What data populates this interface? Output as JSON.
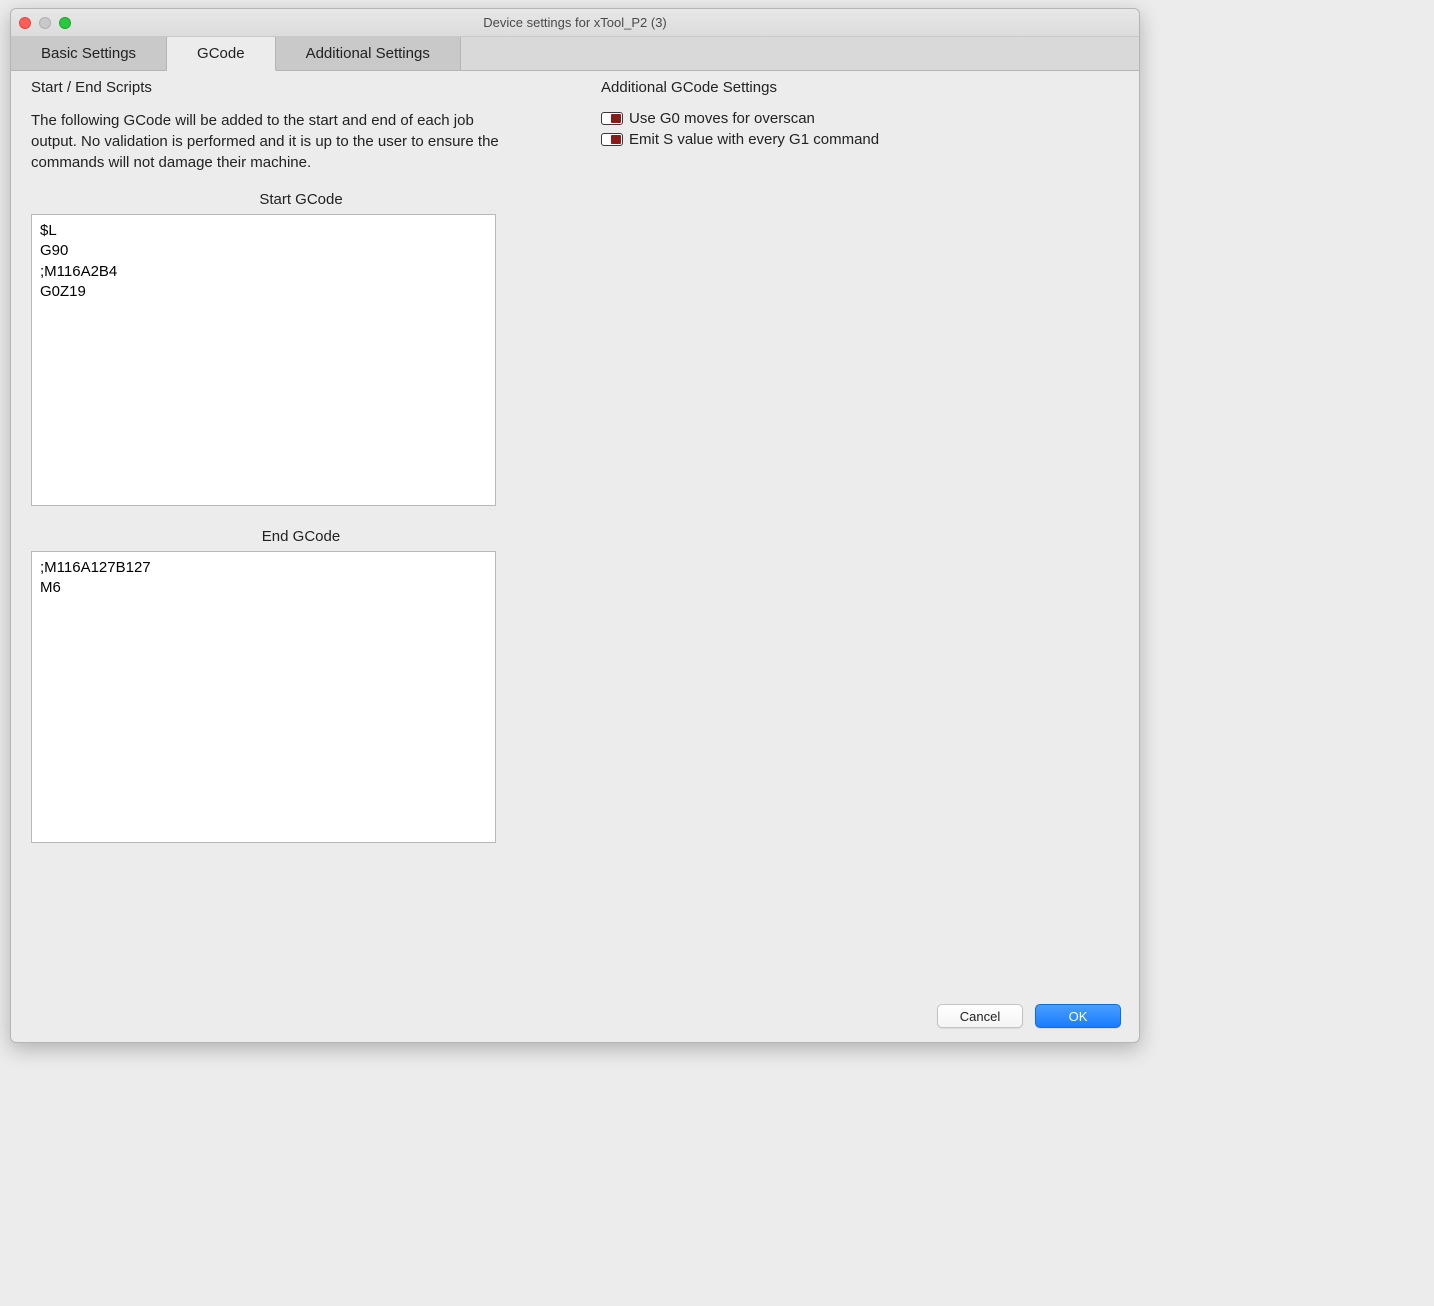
{
  "window": {
    "title": "Device settings for xTool_P2 (3)"
  },
  "tabs": {
    "basic": "Basic Settings",
    "gcode": "GCode",
    "additional": "Additional Settings"
  },
  "left": {
    "section_title": "Start / End Scripts",
    "hint": "The following GCode will be added to the start and end of each job output. No validation is performed and it is up to the user to ensure the commands will not damage their machine.",
    "start_label": "Start GCode",
    "start_code": "$L\nG90\n;M116A2B4\nG0Z19\n",
    "end_label": "End GCode",
    "end_code": ";M116A127B127\nM6"
  },
  "right": {
    "section_title": "Additional GCode Settings",
    "opt_g0": "Use G0 moves for overscan",
    "opt_s": "Emit S value with every G1 command",
    "opt_g0_checked": false,
    "opt_s_checked": false
  },
  "buttons": {
    "cancel": "Cancel",
    "ok": "OK"
  }
}
